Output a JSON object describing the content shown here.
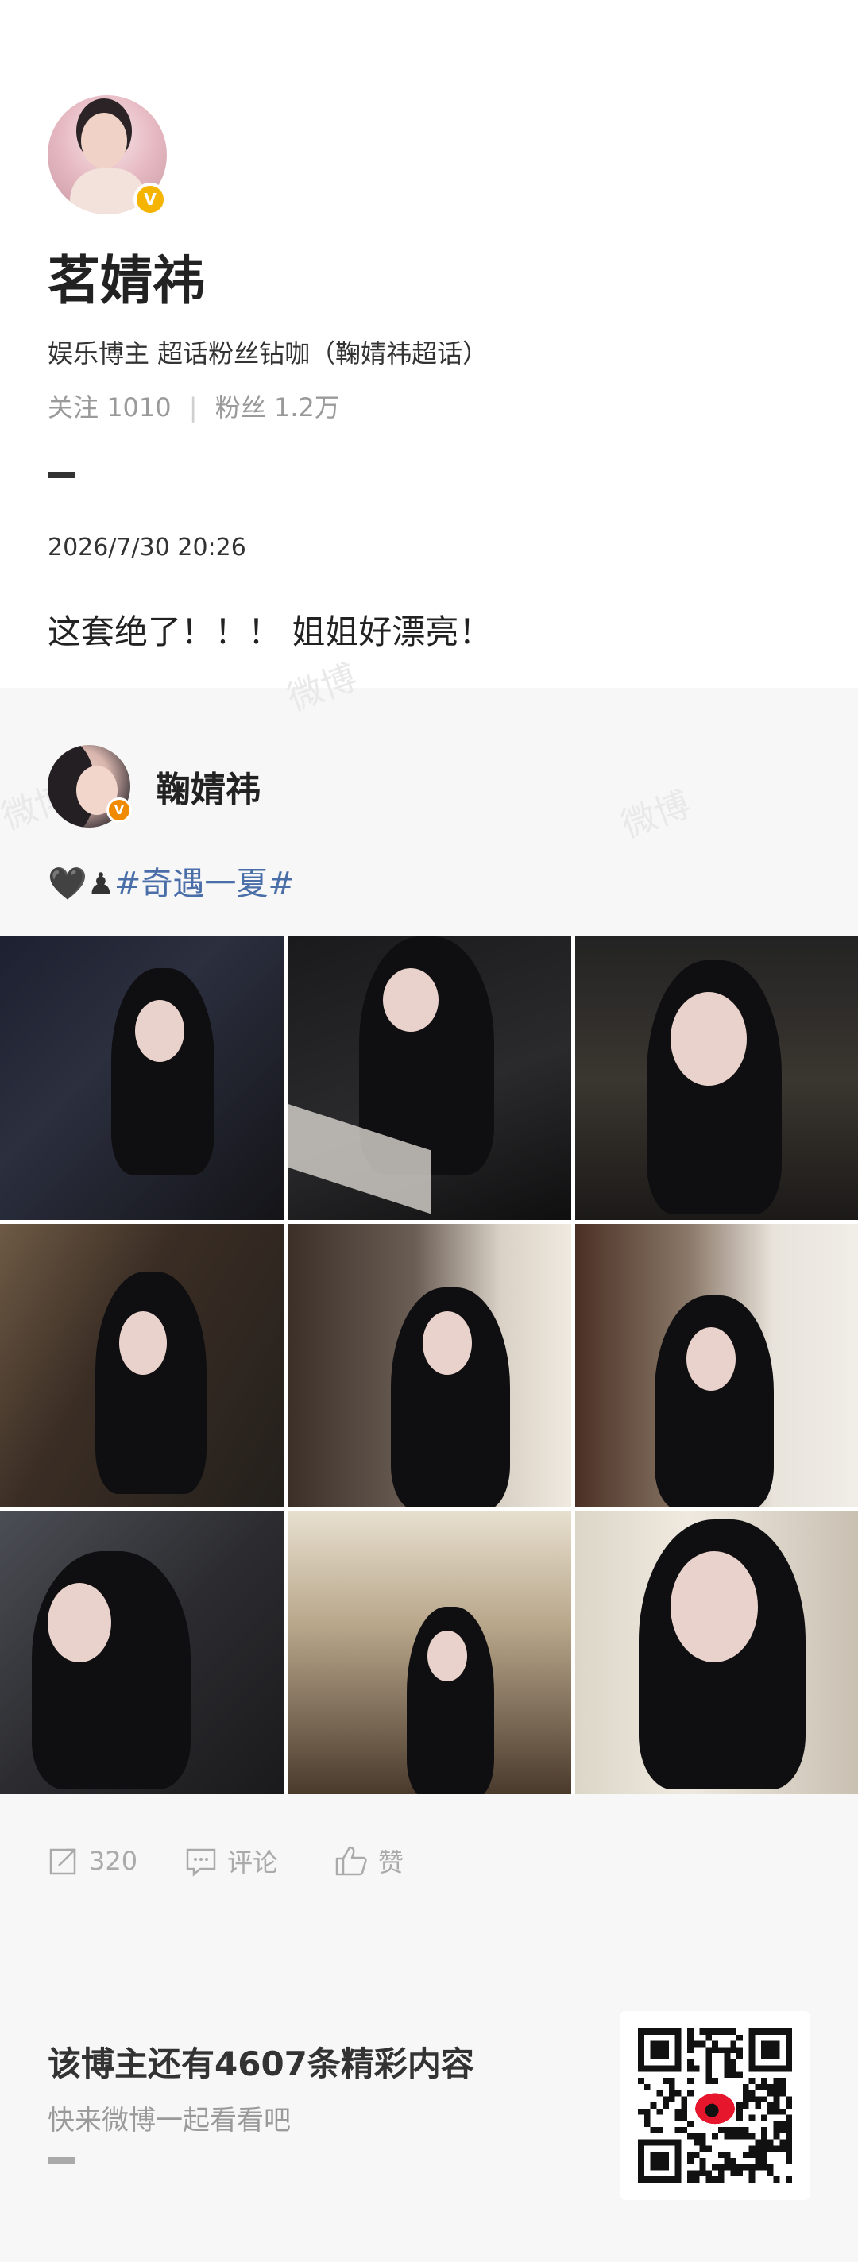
{
  "watermark": "微博",
  "profile": {
    "name": "茗婧祎",
    "description": "娱乐博主 超话粉丝钻咖（鞠婧祎超话）",
    "following_label": "关注",
    "following_count": "1010",
    "followers_label": "粉丝",
    "followers_count": "1.2万",
    "verified_badge": "V"
  },
  "post": {
    "date": "2026/7/30 20:26",
    "text": "这套绝了！！！ 姐姐好漂亮！"
  },
  "repost": {
    "author": "鞠婧祎",
    "emoji_heart": "🖤",
    "emoji_pawn": "♟",
    "hashtag": "#奇遇一夏#",
    "photos": 9
  },
  "actions": {
    "repost_count": "320",
    "comment_label": "评论",
    "like_label": "赞"
  },
  "footer": {
    "title": "该博主还有4607条精彩内容",
    "subtitle": "快来微博一起看看吧"
  },
  "colors": {
    "accent_link": "#4a6ea8",
    "verified_gold": "#f5b400",
    "verified_orange": "#f08a00"
  }
}
